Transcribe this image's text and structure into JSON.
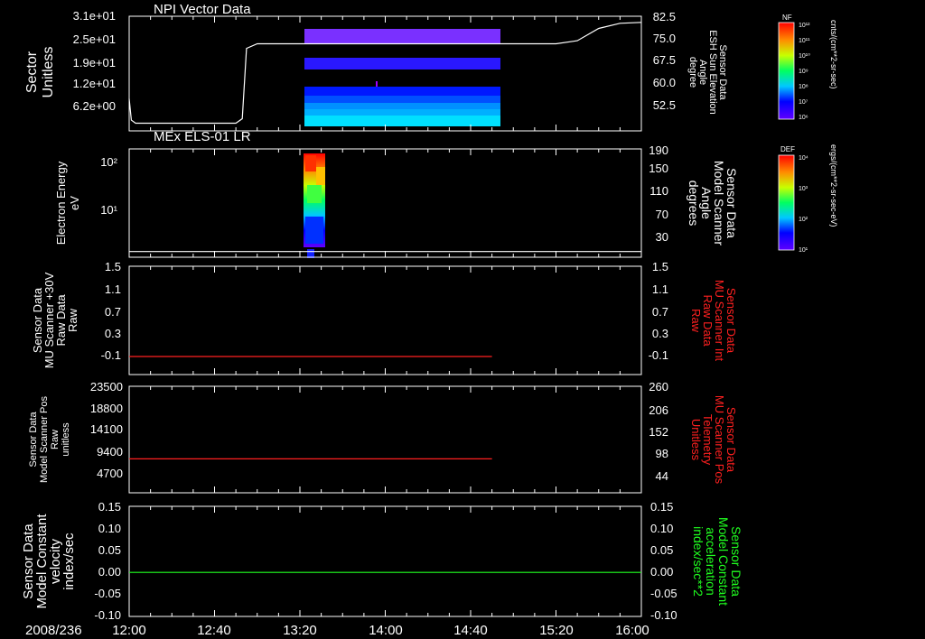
{
  "date_label": "2008/236",
  "time_ticks": [
    "12:00",
    "12:40",
    "13:20",
    "14:00",
    "14:40",
    "15:20",
    "16:00"
  ],
  "colors": {
    "white": "#ffffff",
    "red": "#ff2020",
    "green": "#20ff20"
  },
  "chart_data": [
    {
      "id": "panel1",
      "type": "heatmap",
      "title": "NPI Vector Data",
      "ylabel_left": [
        "Sector",
        "Unitless"
      ],
      "ylabel_right": [
        "Sensor Data",
        "ESH Sun Elevation",
        "Angle",
        "degree"
      ],
      "yticks_left": [
        "3.1e+01",
        "2.5e+01",
        "1.9e+01",
        "1.2e+01",
        "6.2e+00"
      ],
      "yticks_right": [
        "82.5",
        "75.0",
        "67.5",
        "60.0",
        "52.5"
      ],
      "ylim_right": [
        45,
        82.5
      ],
      "heatmap_time_range": [
        "13:20",
        "14:52"
      ],
      "line_series": {
        "name": "ESH Sun Elevation Angle",
        "x": [
          "12:00",
          "12:01",
          "12:03",
          "12:50",
          "12:53",
          "12:55",
          "13:00",
          "15:20",
          "15:30",
          "15:40",
          "15:50",
          "16:00"
        ],
        "y": [
          55.5,
          48.5,
          47.5,
          47.5,
          49,
          72,
          73.5,
          73.5,
          74.5,
          78.5,
          80.2,
          80.5
        ]
      }
    },
    {
      "id": "panel2",
      "type": "heatmap",
      "title": "MEx ELS-01 LR",
      "ylabel_left": [
        "Electron Energy",
        "eV"
      ],
      "ylabel_right": [
        "Sensor Data",
        "Model Scanner",
        "Angle",
        "degrees"
      ],
      "yticks_left": [
        "10²",
        "10¹"
      ],
      "yticks_right": [
        "190",
        "150",
        "110",
        "70",
        "30"
      ],
      "ylim_right": [
        0,
        190
      ],
      "heatmap_time_range": [
        "13:20",
        "13:35"
      ],
      "line_series": {
        "name": "Model Scanner Angle",
        "x": [
          "12:00",
          "16:00"
        ],
        "y": [
          10,
          10
        ]
      }
    },
    {
      "id": "panel3",
      "type": "line",
      "ylabel_left": [
        "Sensor Data",
        "MU Scanner +30V",
        "Raw Data",
        "Raw"
      ],
      "ylabel_right": [
        "Sensor Data",
        "MU Scanner Int",
        "Raw Data",
        "Raw"
      ],
      "yticks_left": [
        "1.5",
        "1.1",
        "0.7",
        "0.3",
        "-0.1"
      ],
      "yticks_right": [
        "1.5",
        "1.1",
        "0.7",
        "0.3",
        "-0.1"
      ],
      "ylim": [
        -0.3,
        1.5
      ],
      "series": [
        {
          "name": "MU Scanner Int",
          "x": [
            "12:00",
            "14:50"
          ],
          "y": [
            0.0,
            0.0
          ]
        }
      ]
    },
    {
      "id": "panel4",
      "type": "line",
      "ylabel_left": [
        "Sensor Data",
        "Model Scanner Pos",
        "Raw",
        "unitless"
      ],
      "ylabel_right": [
        "Sensor Data",
        "MU Scanner Pos",
        "Telemetry",
        "Unitless"
      ],
      "yticks_left": [
        "23500",
        "18800",
        "14100",
        "9400",
        "4700"
      ],
      "yticks_right": [
        "260",
        "206",
        "152",
        "98",
        "44"
      ],
      "ylim": [
        0,
        23500
      ],
      "series": [
        {
          "name": "MU Scanner Pos Telemetry",
          "x": [
            "12:00",
            "14:50"
          ],
          "y": [
            7500,
            7500
          ]
        }
      ]
    },
    {
      "id": "panel5",
      "type": "line",
      "ylabel_left": [
        "Sensor Data",
        "Model Constant",
        "velocity",
        "index/sec"
      ],
      "ylabel_right": [
        "Sensor Data",
        "Model Constant",
        "acceleration",
        "index/sec**2"
      ],
      "yticks_left": [
        "0.15",
        "0.10",
        "0.05",
        "0.00",
        "-0.05",
        "-0.10"
      ],
      "yticks_right": [
        "0.15",
        "0.10",
        "0.05",
        "0.00",
        "-0.05",
        "-0.10"
      ],
      "ylim": [
        -0.1,
        0.15
      ],
      "series": [
        {
          "name": "Model Constant acceleration",
          "x": [
            "12:00",
            "16:00"
          ],
          "y": [
            0.0,
            0.0
          ]
        }
      ]
    }
  ],
  "colorbars": [
    {
      "id": "cb1",
      "label": "NF",
      "units": "cnts/(cm**2-sr-sec)",
      "ticks": [
        "10¹²",
        "10¹¹",
        "10¹⁰",
        "10⁹",
        "10⁸",
        "10⁷",
        "10⁶"
      ]
    },
    {
      "id": "cb2",
      "label": "DEF",
      "units": "ergs/(cm**2-sr-sec-eV)",
      "ticks": [
        "10⁴",
        "10³",
        "10²",
        "10¹"
      ]
    }
  ]
}
